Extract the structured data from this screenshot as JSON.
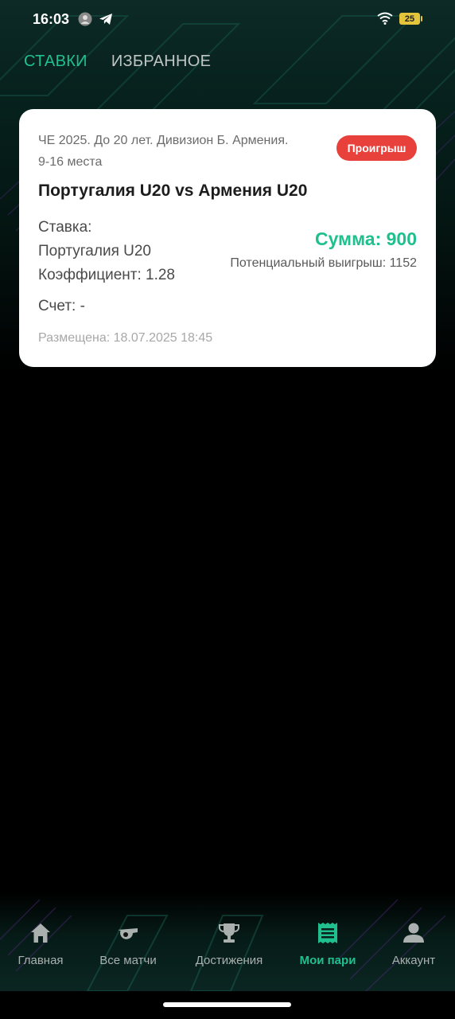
{
  "status_bar": {
    "time": "16:03",
    "battery": "25",
    "icons": [
      "avatar-icon",
      "telegram-icon",
      "wifi-icon",
      "battery-icon"
    ]
  },
  "tabs": [
    {
      "label": "СТАВКИ",
      "active": true
    },
    {
      "label": "ИЗБРАННОЕ",
      "active": false
    }
  ],
  "bet_card": {
    "league_line1": "ЧЕ 2025. До 20 лет. Дивизион Б. Армения.",
    "league_line2": "9-16 места",
    "status_badge": "Проигрыш",
    "match": "Португалия U20 vs Армения U20",
    "bet_label": "Ставка:",
    "bet_team": "Португалия U20",
    "odds": "Коэффициент: 1.28",
    "amount": "Сумма: 900",
    "potential_win": "Потенциальный выигрыш: 1152",
    "score": "Счет: -",
    "placed": "Размещена: 18.07.2025 18:45"
  },
  "bottom_nav": [
    {
      "label": "Главная",
      "icon": "home-icon",
      "active": false
    },
    {
      "label": "Все матчи",
      "icon": "whistle-icon",
      "active": false
    },
    {
      "label": "Достижения",
      "icon": "trophy-icon",
      "active": false
    },
    {
      "label": "Мои пари",
      "icon": "receipt-icon",
      "active": true
    },
    {
      "label": "Аккаунт",
      "icon": "account-icon",
      "active": false
    }
  ],
  "colors": {
    "accent": "#1fc08e",
    "loss_badge": "#e8413b",
    "background": "#000000",
    "card": "#ffffff"
  }
}
